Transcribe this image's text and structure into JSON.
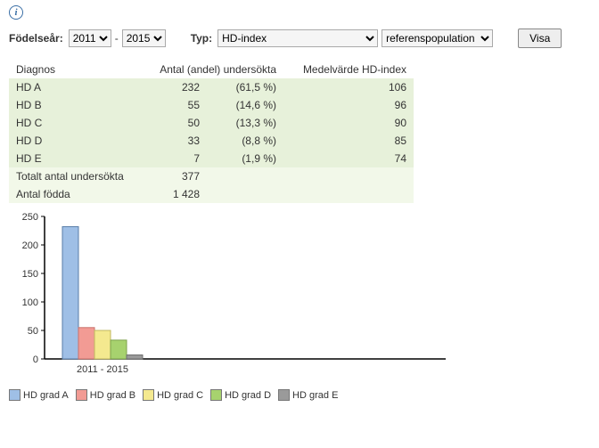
{
  "info_glyph": "i",
  "controls": {
    "birthyear_label": "Födelseår:",
    "year_from": "2011",
    "year_to": "2015",
    "sep": "-",
    "type_label": "Typ:",
    "type_value": "HD-index",
    "pop_value": "referenspopulation",
    "show_button": "Visa"
  },
  "table": {
    "headers": {
      "diagnosis": "Diagnos",
      "count": "Antal (andel) undersökta",
      "mean": "Medelvärde HD-index"
    },
    "rows": [
      {
        "label": "HD A",
        "count": "232",
        "pct": "(61,5 %)",
        "mean": "106"
      },
      {
        "label": "HD B",
        "count": "55",
        "pct": "(14,6 %)",
        "mean": "96"
      },
      {
        "label": "HD C",
        "count": "50",
        "pct": "(13,3 %)",
        "mean": "90"
      },
      {
        "label": "HD D",
        "count": "33",
        "pct": "(8,8 %)",
        "mean": "85"
      },
      {
        "label": "HD E",
        "count": "7",
        "pct": "(1,9 %)",
        "mean": "74"
      }
    ],
    "totals": [
      {
        "label": "Totalt antal undersökta",
        "value": "377"
      },
      {
        "label": "Antal födda",
        "value": "1 428"
      }
    ]
  },
  "chart_data": {
    "type": "bar",
    "categories": [
      "2011 - 2015"
    ],
    "series": [
      {
        "name": "HD grad A",
        "values": [
          232
        ],
        "color": "#9fbfe6",
        "stroke": "#5a7ea8"
      },
      {
        "name": "HD grad B",
        "values": [
          55
        ],
        "color": "#f29b94",
        "stroke": "#c9716b"
      },
      {
        "name": "HD grad C",
        "values": [
          50
        ],
        "color": "#f4e98f",
        "stroke": "#c0b75f"
      },
      {
        "name": "HD grad D",
        "values": [
          33
        ],
        "color": "#a7d26e",
        "stroke": "#7ca24b"
      },
      {
        "name": "HD grad E",
        "values": [
          7
        ],
        "color": "#9a9a9a",
        "stroke": "#6f6f6f"
      }
    ],
    "ylim": [
      0,
      250
    ],
    "ticks": [
      0,
      50,
      100,
      150,
      200,
      250
    ],
    "xlabel": "",
    "ylabel": "",
    "title": ""
  },
  "legend": [
    {
      "label": "HD grad A",
      "color": "#9fbfe6"
    },
    {
      "label": "HD grad B",
      "color": "#f29b94"
    },
    {
      "label": "HD grad C",
      "color": "#f4e98f"
    },
    {
      "label": "HD grad D",
      "color": "#a7d26e"
    },
    {
      "label": "HD grad E",
      "color": "#9a9a9a"
    }
  ]
}
